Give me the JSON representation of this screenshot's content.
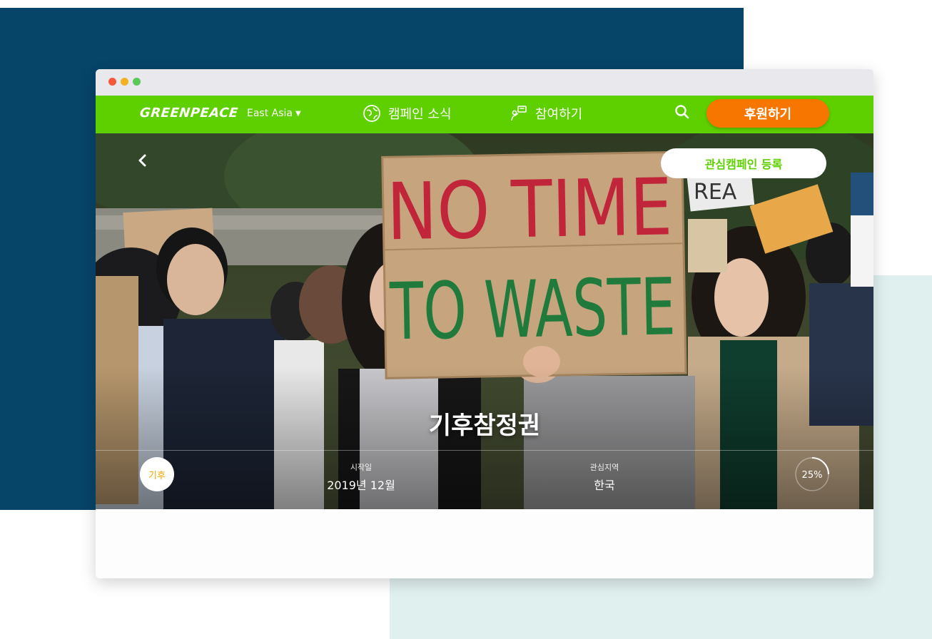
{
  "nav": {
    "logo": "GREENPEACE",
    "region": "East Asia",
    "campaign_news": "캠페인 소식",
    "participate": "참여하기",
    "donate": "후원하기"
  },
  "hero": {
    "follow_button": "관심캠페인 등록",
    "title": "기후참정권",
    "category_tag": "기후",
    "start_label": "시작일",
    "start_value": "2019년 12월",
    "area_label": "관심지역",
    "area_value": "한국",
    "progress_text": "25%",
    "progress_fraction": 0.25
  },
  "photo_text": {
    "sign_line1": "NO TIME",
    "sign_line2": "TO WASTE"
  },
  "colors": {
    "navy": "#064468",
    "mint": "#e0f0ef",
    "brand_green": "#5ed000",
    "donate_orange": "#f77600",
    "tag_yellow": "#f7a600"
  }
}
